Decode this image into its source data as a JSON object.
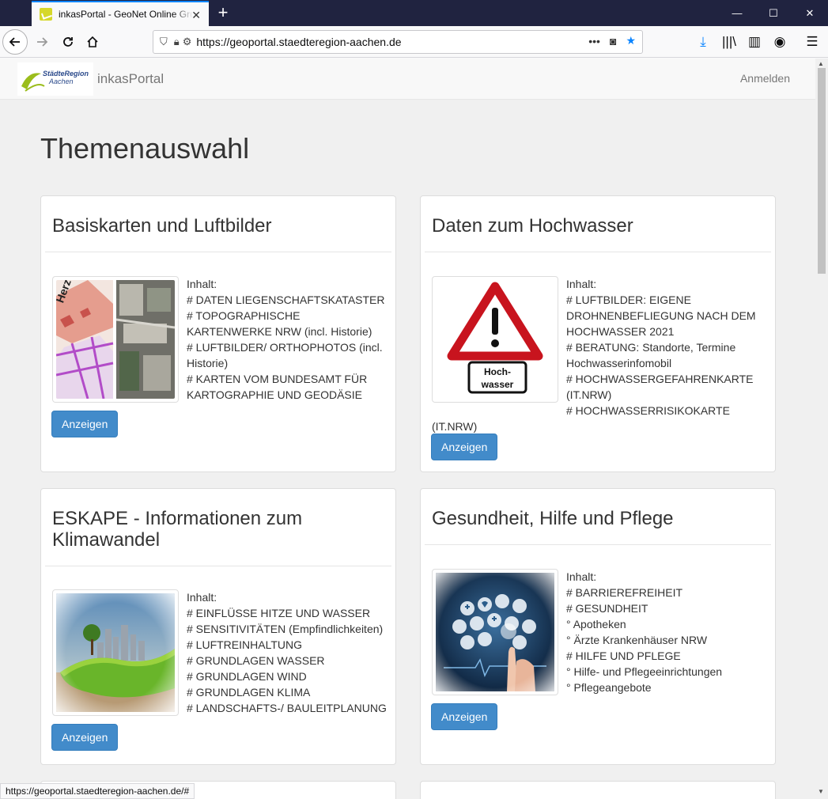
{
  "browser": {
    "tab_title": "inkasPortal - GeoNet Online Grund",
    "url": "https://geoportal.staedteregion-aachen.de",
    "status_url": "https://geoportal.staedteregion-aachen.de/#"
  },
  "site": {
    "logo_text_1": "StädteRegion",
    "logo_text_2": "Aachen",
    "brand": "inkasPortal",
    "login": "Anmelden"
  },
  "page": {
    "title": "Themenauswahl"
  },
  "cards": [
    {
      "title": "Basiskarten und Luftbilder",
      "lines": [
        "Inhalt:",
        "# DATEN LIEGENSCHAFTSKATASTER",
        "# TOPOGRAPHISCHE KARTENWERKE NRW (incl. Historie)",
        "# LUFTBILDER/ ORTHOPHOTOS (incl. Historie)",
        "# KARTEN VOM BUNDESAMT FÜR KARTOGRAPHIE UND GEODÄSIE"
      ],
      "button": "Anzeigen"
    },
    {
      "title": "Daten zum Hochwasser",
      "lines": [
        "Inhalt:",
        "# LUFTBILDER: EIGENE DROHNENBEFLIEGUNG NACH DEM HOCHWASSER 2021",
        "# BERATUNG: Standorte, Termine Hochwasserinfomobil",
        "# HOCHWASSERGEFAHRENKARTE (IT.NRW)",
        "# HOCHWASSERRISIKOKARTE"
      ],
      "tail": "(IT.NRW)",
      "sign_text_1": "Hoch-",
      "sign_text_2": "wasser",
      "button": "Anzeigen"
    },
    {
      "title": "ESKAPE - Informationen zum Klimawandel",
      "lines": [
        "Inhalt:",
        "# EINFLÜSSE HITZE UND WASSER",
        "# SENSITIVITÄTEN (Empfindlichkeiten)",
        "# LUFTREINHALTUNG",
        "# GRUNDLAGEN WASSER",
        "# GRUNDLAGEN WIND",
        "# GRUNDLAGEN KLIMA",
        "# LANDSCHAFTS-/ BAULEITPLANUNG"
      ],
      "button": "Anzeigen"
    },
    {
      "title": "Gesundheit, Hilfe und Pflege",
      "lines": [
        "Inhalt:",
        "# BARRIEREFREIHEIT",
        "# GESUNDHEIT",
        "° Apotheken",
        "° Ärzte Krankenhäuser NRW",
        "# HILFE UND PFLEGE",
        "° Hilfe- und Pflegeeinrichtungen",
        "° Pflegeangebote"
      ],
      "button": "Anzeigen"
    }
  ]
}
